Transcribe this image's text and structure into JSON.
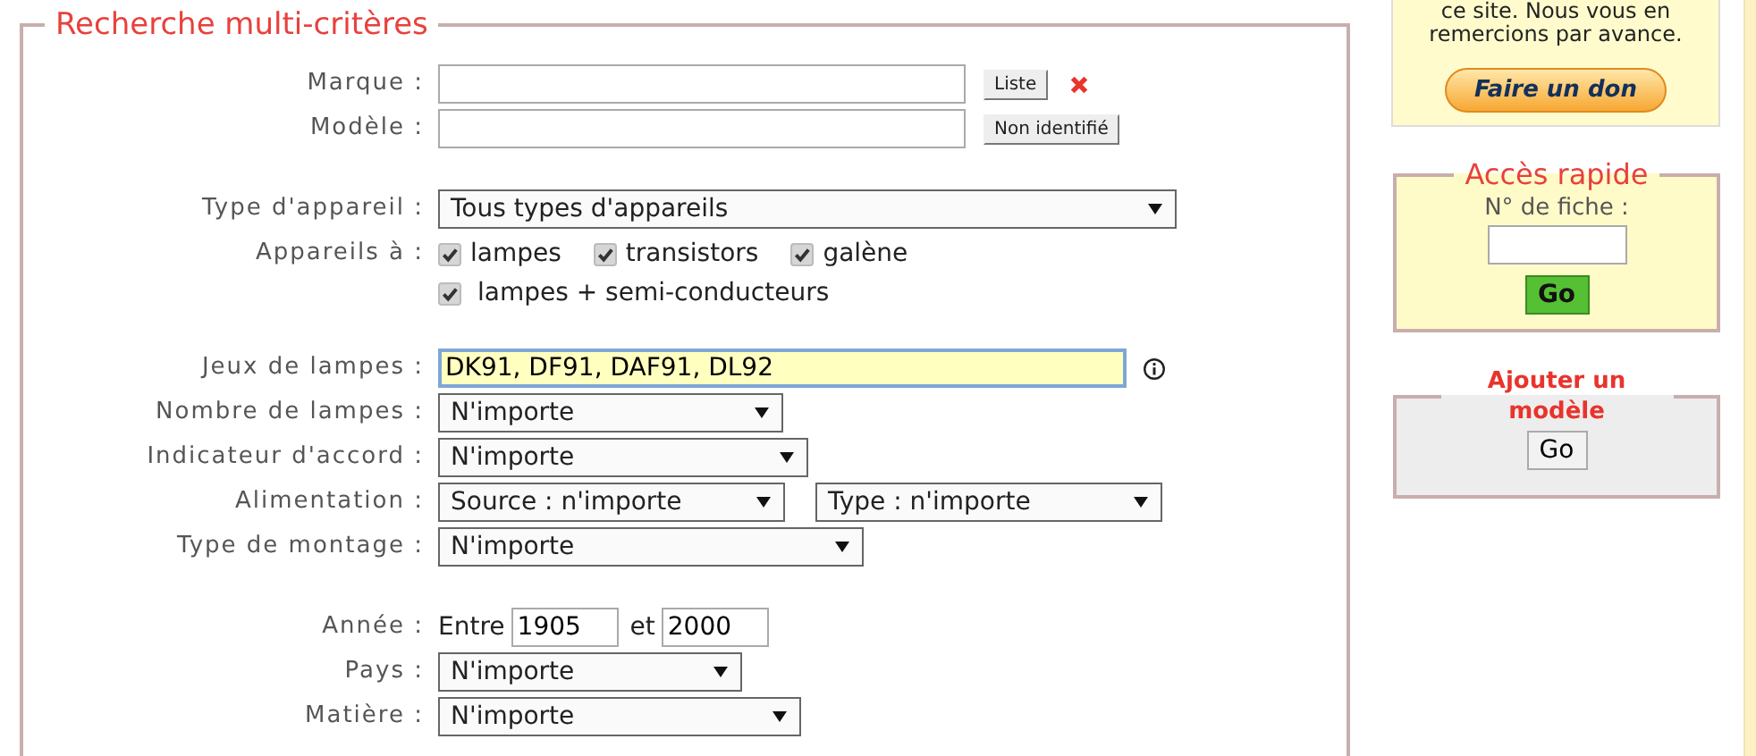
{
  "search_panel": {
    "title": "Recherche multi-critères",
    "groups": [
      [
        {
          "kind": "text",
          "label": "Marque :",
          "buttons": [
            "Liste"
          ],
          "clear_icon": true
        },
        {
          "kind": "text",
          "label": "Modèle :",
          "buttons": [
            "Non identifié"
          ],
          "clear_icon": false
        }
      ],
      [
        {
          "kind": "select",
          "label": "Type d'appareil :",
          "selects": [
            "Tous types d'appareils"
          ]
        },
        {
          "kind": "checks",
          "label": "Appareils à :",
          "lines": [
            [
              {
                "label": "lampes",
                "checked": true
              },
              {
                "label": "transistors",
                "checked": true
              },
              {
                "label": "galène",
                "checked": true
              }
            ],
            [
              {
                "label": "lampes + semi-conducteurs",
                "checked": true
              }
            ]
          ]
        }
      ],
      [
        {
          "kind": "text",
          "label": "Jeux de lampes :",
          "value": "DK91, DF91, DAF91, DL92",
          "focused": true,
          "info_icon": true
        },
        {
          "kind": "select",
          "label": "Nombre de lampes :",
          "selects": [
            "N'importe"
          ]
        },
        {
          "kind": "select",
          "label": "Indicateur d'accord :",
          "selects": [
            "N'importe"
          ]
        },
        {
          "kind": "select",
          "label": "Alimentation :",
          "selects": [
            "Source : n'importe",
            "Type : n'importe"
          ]
        },
        {
          "kind": "select",
          "label": "Type de montage :",
          "selects": [
            "N'importe"
          ]
        }
      ],
      [
        {
          "kind": "range",
          "label": "Année :",
          "prefix": "Entre",
          "from": "1905",
          "joiner": "et",
          "to": "2000"
        },
        {
          "kind": "select",
          "label": "Pays :",
          "selects": [
            "N'importe"
          ]
        },
        {
          "kind": "select",
          "label": "Matière :",
          "selects": [
            "N'importe"
          ]
        }
      ]
    ]
  },
  "sidebar": {
    "donation": {
      "text": "ce site. Nous vous en remercions par avance.",
      "button": "Faire un don"
    },
    "quick_access": {
      "title": "Accès rapide",
      "label": "N° de fiche :",
      "button": "Go"
    },
    "add_model": {
      "title": "Ajouter un modèle",
      "button": "Go"
    }
  }
}
